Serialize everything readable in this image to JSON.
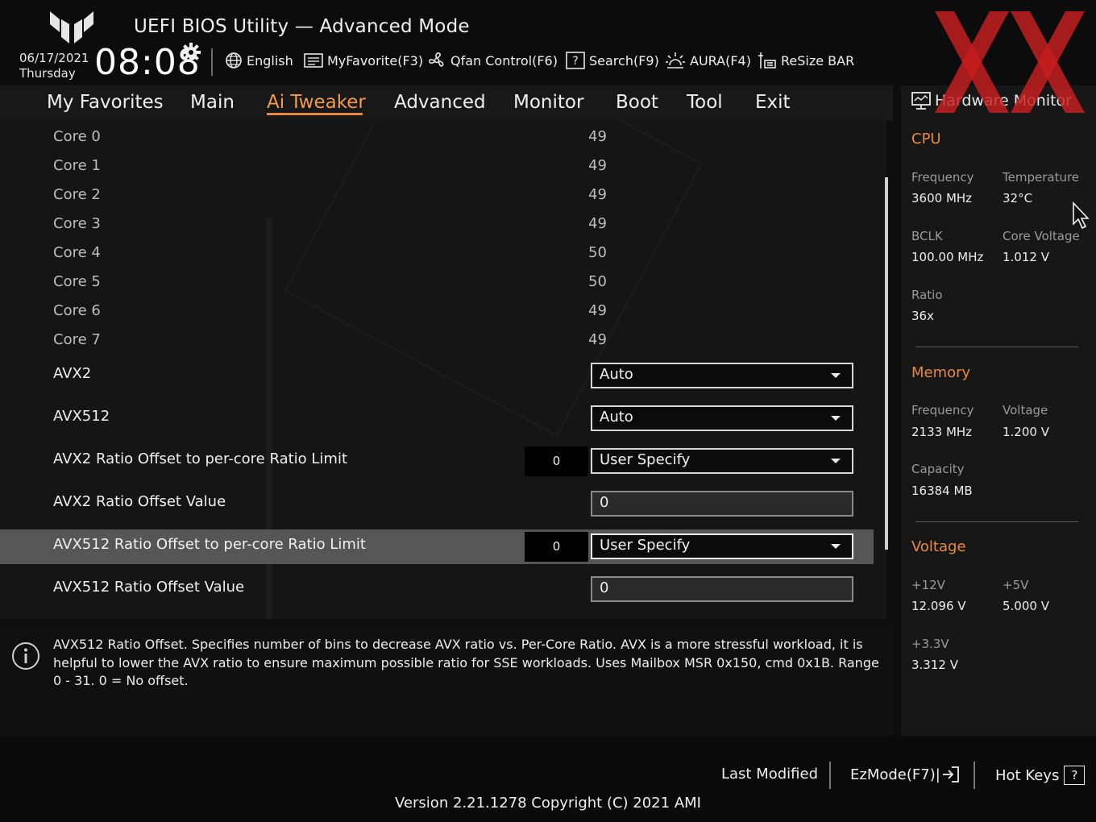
{
  "header": {
    "title": "UEFI BIOS Utility — Advanced Mode",
    "date": "06/17/2021",
    "day": "Thursday",
    "time": "08:08",
    "toolbar": [
      {
        "label": "English",
        "icon": "globe-icon"
      },
      {
        "label": "MyFavorite(F3)",
        "icon": "favorite-list-icon"
      },
      {
        "label": "Qfan Control(F6)",
        "icon": "fan-icon"
      },
      {
        "label": "Search(F9)",
        "icon": "search-help-icon"
      },
      {
        "label": "AURA(F4)",
        "icon": "aura-light-icon"
      },
      {
        "label": "ReSize BAR",
        "icon": "resize-bar-icon"
      }
    ]
  },
  "nav": {
    "tabs": [
      {
        "label": "My Favorites"
      },
      {
        "label": "Main"
      },
      {
        "label": "Ai Tweaker",
        "active": true
      },
      {
        "label": "Advanced"
      },
      {
        "label": "Monitor"
      },
      {
        "label": "Boot"
      },
      {
        "label": "Tool"
      },
      {
        "label": "Exit"
      }
    ]
  },
  "cores": [
    {
      "label": "Core 0",
      "value": "49"
    },
    {
      "label": "Core 1",
      "value": "49"
    },
    {
      "label": "Core 2",
      "value": "49"
    },
    {
      "label": "Core 3",
      "value": "49"
    },
    {
      "label": "Core 4",
      "value": "50"
    },
    {
      "label": "Core 5",
      "value": "50"
    },
    {
      "label": "Core 6",
      "value": "49"
    },
    {
      "label": "Core 7",
      "value": "49"
    }
  ],
  "settings": [
    {
      "label": "AVX2",
      "type": "dropdown",
      "value": "Auto"
    },
    {
      "label": "AVX512",
      "type": "dropdown",
      "value": "Auto"
    },
    {
      "label": "AVX2 Ratio Offset to per-core Ratio Limit",
      "type": "dropdown",
      "value": "User Specify",
      "current": "0"
    },
    {
      "label": "AVX2 Ratio Offset Value",
      "type": "text",
      "value": "0"
    },
    {
      "label": "AVX512 Ratio Offset to per-core Ratio Limit",
      "type": "dropdown",
      "value": "User Specify",
      "current": "0",
      "selected": true
    },
    {
      "label": "AVX512 Ratio Offset Value",
      "type": "text",
      "value": "0"
    }
  ],
  "help": {
    "text": "AVX512 Ratio Offset. Specifies number of bins to decrease AVX ratio vs. Per-Core Ratio. AVX is a more stressful workload, it is helpful to lower the AVX ratio to ensure maximum possible ratio for SSE workloads. Uses Mailbox MSR 0x150, cmd 0x1B. Range 0 - 31. 0 = No offset."
  },
  "hw_monitor": {
    "title": "Hardware Monitor",
    "cpu": {
      "heading": "CPU",
      "frequency_label": "Frequency",
      "frequency": "3600 MHz",
      "temperature_label": "Temperature",
      "temperature": "32°C",
      "bclk_label": "BCLK",
      "bclk": "100.00 MHz",
      "core_voltage_label": "Core Voltage",
      "core_voltage": "1.012 V",
      "ratio_label": "Ratio",
      "ratio": "36x"
    },
    "memory": {
      "heading": "Memory",
      "frequency_label": "Frequency",
      "frequency": "2133 MHz",
      "voltage_label": "Voltage",
      "voltage": "1.200 V",
      "capacity_label": "Capacity",
      "capacity": "16384 MB"
    },
    "voltage": {
      "heading": "Voltage",
      "v12_label": "+12V",
      "v12": "12.096 V",
      "v5_label": "+5V",
      "v5": "5.000 V",
      "v33_label": "+3.3V",
      "v33": "3.312 V"
    }
  },
  "footer": {
    "last_modified": "Last Modified",
    "ezmode": "EzMode(F7)|",
    "hotkeys": "Hot Keys",
    "hotkeys_glyph": "?",
    "version": "Version 2.21.1278 Copyright (C) 2021 AMI"
  },
  "colors": {
    "accent": "#e8893e",
    "selected_row": "#565656",
    "watermark": "#c81e1e"
  }
}
